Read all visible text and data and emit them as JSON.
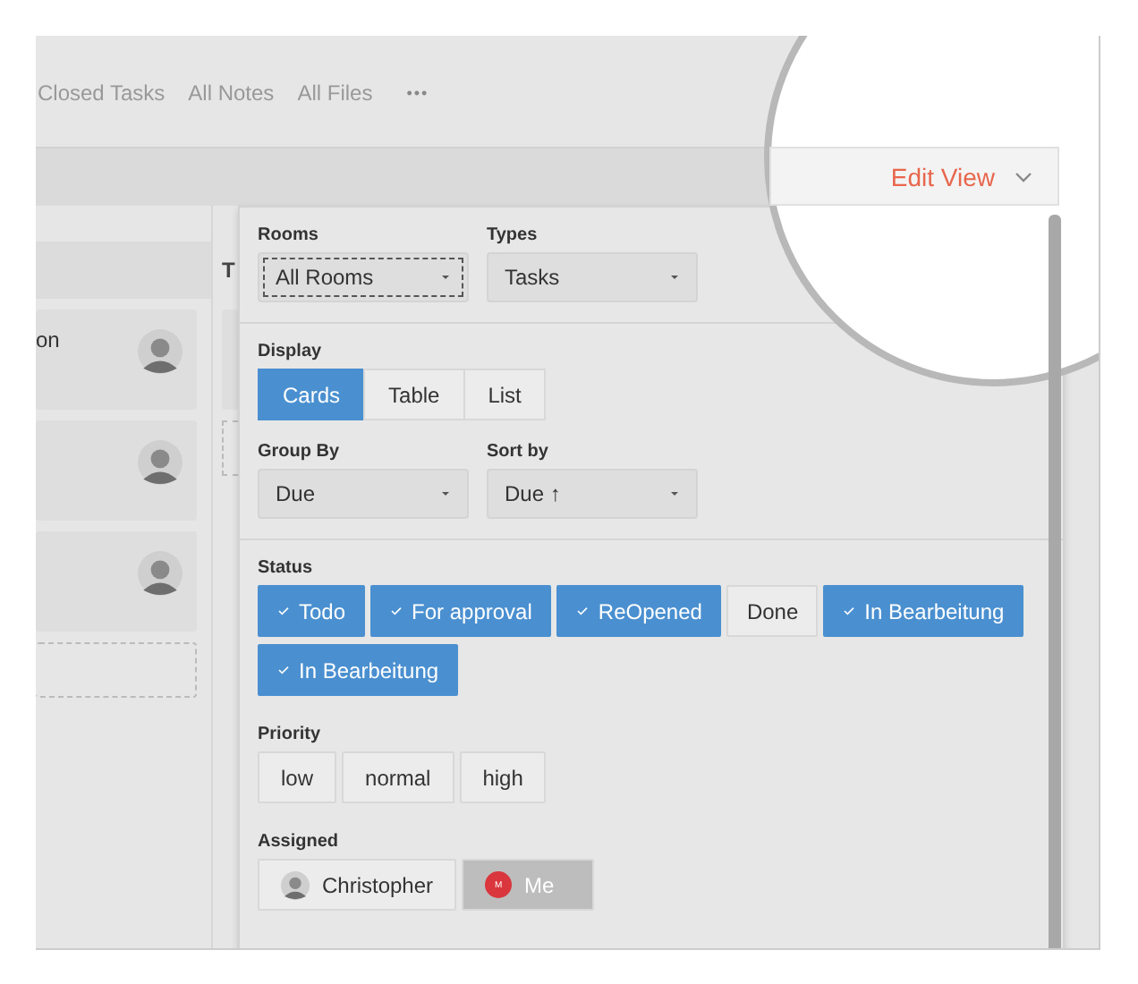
{
  "nav": {
    "items": [
      "Closed Tasks",
      "All Notes",
      "All Files"
    ],
    "more": "•••"
  },
  "edit_view": {
    "label": "Edit View"
  },
  "board": {
    "columns": [
      {
        "cards": [
          {
            "text": "on",
            "kind": "avatar"
          },
          {
            "kind": "avatar"
          },
          {
            "kind": "avatar"
          }
        ],
        "placeholder": true
      },
      {
        "header": "T"
      }
    ]
  },
  "panel": {
    "rooms": {
      "label": "Rooms",
      "value": "All Rooms",
      "focused": true
    },
    "types": {
      "label": "Types",
      "value": "Tasks",
      "focused": false
    },
    "display": {
      "label": "Display",
      "options": [
        {
          "label": "Cards",
          "selected": true
        },
        {
          "label": "Table",
          "selected": false
        },
        {
          "label": "List",
          "selected": false
        }
      ]
    },
    "group_by": {
      "label": "Group By",
      "value": "Due"
    },
    "sort_by": {
      "label": "Sort by",
      "value": "Due ↑"
    },
    "status": {
      "label": "Status",
      "options": [
        {
          "label": "Todo",
          "checked": true
        },
        {
          "label": "For approval",
          "checked": true
        },
        {
          "label": "ReOpened",
          "checked": true
        },
        {
          "label": "Done",
          "checked": false
        },
        {
          "label": "In Bearbeitung",
          "checked": true
        },
        {
          "label": "In Bearbeitung",
          "checked": true
        }
      ]
    },
    "priority": {
      "label": "Priority",
      "options": [
        {
          "label": "low",
          "selected": false
        },
        {
          "label": "normal",
          "selected": false
        },
        {
          "label": "high",
          "selected": false
        }
      ]
    },
    "assigned": {
      "label": "Assigned",
      "people": [
        {
          "kind": "person",
          "name": "Christopher",
          "disabled": false
        },
        {
          "kind": "initial",
          "name": "Me",
          "initial": "M",
          "color": "#d9363e",
          "disabled": true
        }
      ]
    }
  }
}
